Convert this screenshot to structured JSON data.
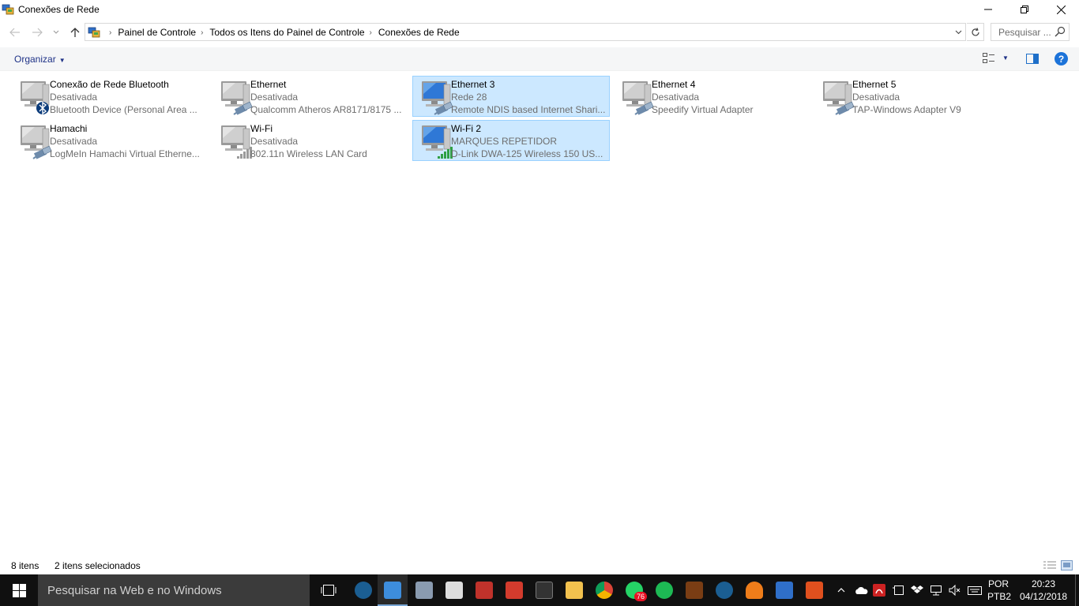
{
  "window": {
    "title": "Conexões de Rede",
    "controls": {
      "minimize": "—",
      "maximize": "❐",
      "close": "✕"
    }
  },
  "address": {
    "crumbs": [
      "Painel de Controle",
      "Todos os Itens do Painel de Controle",
      "Conexões de Rede"
    ],
    "search_placeholder": "Pesquisar ..."
  },
  "command_bar": {
    "organize_label": "Organizar"
  },
  "items": [
    {
      "name": "Conexão de Rede Bluetooth",
      "status": "Desativada",
      "device": "Bluetooth Device (Personal Area ...",
      "badge": "bluetooth",
      "selected": false
    },
    {
      "name": "Ethernet",
      "status": "Desativada",
      "device": "Qualcomm Atheros AR8171/8175 ...",
      "badge": "cable",
      "selected": false
    },
    {
      "name": "Ethernet 3",
      "status": "Rede  28",
      "device": "Remote NDIS based Internet Shari...",
      "badge": "cable",
      "selected": true
    },
    {
      "name": "Ethernet 4",
      "status": "Desativada",
      "device": "Speedify Virtual Adapter",
      "badge": "cable",
      "selected": false
    },
    {
      "name": "Ethernet 5",
      "status": "Desativada",
      "device": "TAP-Windows Adapter V9",
      "badge": "cable",
      "selected": false
    },
    {
      "name": "Hamachi",
      "status": "Desativada",
      "device": "LogMeIn Hamachi Virtual Etherne...",
      "badge": "cable",
      "selected": false
    },
    {
      "name": "Wi-Fi",
      "status": "Desativada",
      "device": "802.11n Wireless LAN Card",
      "badge": "wifi-gray",
      "selected": false
    },
    {
      "name": "Wi-Fi 2",
      "status": "MARQUES REPETIDOR",
      "device": "D-Link DWA-125 Wireless 150 US...",
      "badge": "wifi-green",
      "selected": true
    }
  ],
  "status_bar": {
    "count": "8 itens",
    "selected": "2 itens selecionados"
  },
  "taskbar": {
    "search_placeholder": "Pesquisar na Web e no Windows",
    "whatsapp_badge": "76",
    "language": [
      "POR",
      "PTB2"
    ],
    "time": "20:23",
    "date": "04/12/2018"
  },
  "colors": {
    "selection_bg": "#cce8ff",
    "selection_border": "#99d1ff",
    "link_blue": "#1e3287",
    "taskbar_bg": "#101010"
  }
}
